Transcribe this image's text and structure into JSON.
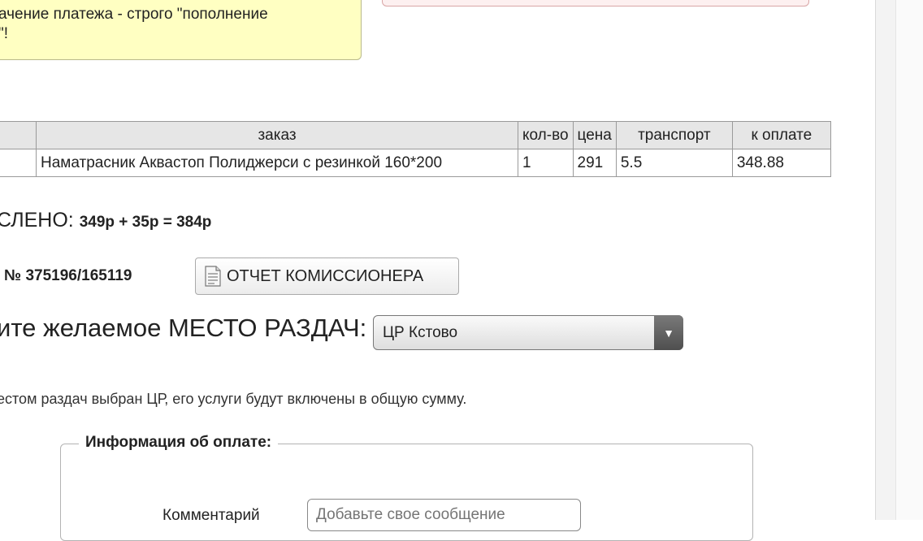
{
  "notice": {
    "line1": "ачение платежа - строго \"пополнение",
    "line2": "\"!"
  },
  "orders_table": {
    "headers": [
      "",
      "заказ",
      "кол-во",
      "цена",
      "транспорт",
      "к оплате"
    ],
    "rows": [
      [
        "",
        "Наматрасник Аквастоп Полиджерси с резинкой 160*200",
        "1",
        "291",
        "5.5",
        "348.88"
      ]
    ]
  },
  "total": {
    "label": "СЛЕНО:",
    "sum": "349р + 35р = 384р"
  },
  "order": {
    "number": "№ 375196/165119",
    "report_button": "ОТЧЕТ КОМИССИОНЕРА"
  },
  "distribution": {
    "label": "ите желаемое МЕСТО РАЗДАЧ:",
    "selected": "ЦР Кстово",
    "note": "естом раздач выбран ЦР, его услуги будут включены в общую сумму."
  },
  "payment_info": {
    "legend": "Информация об оплате:",
    "comment_label": "Комментарий",
    "comment_placeholder": "Добавьте свое сообщение"
  },
  "colors": {
    "notice_bg": "#ffffc2",
    "header_bg": "#e6e6e6",
    "select_arrow": "#5a5a5a"
  }
}
